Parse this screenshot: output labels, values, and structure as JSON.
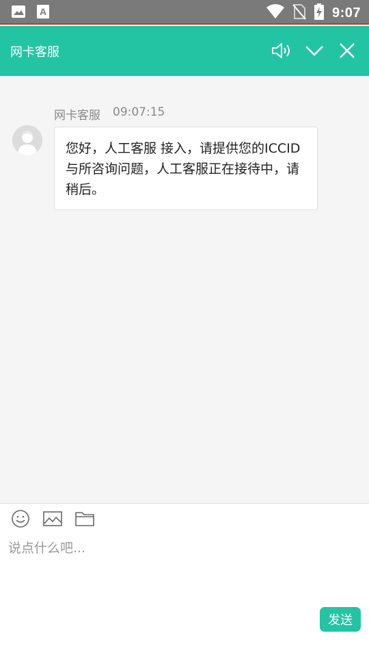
{
  "status_bar": {
    "time": "9:07",
    "icons": [
      "image-icon",
      "font-icon",
      "wifi-icon",
      "no-sim-icon",
      "battery-charging-icon"
    ]
  },
  "header": {
    "title": "网卡客服",
    "icons": [
      "volume-icon",
      "chevron-down-icon",
      "close-icon"
    ],
    "accent_color": "#23c4a3"
  },
  "chat": {
    "messages": [
      {
        "sender": "网卡客服",
        "time": "09:07:15",
        "text": "您好，人工客服 接入，请提供您的ICCID与所咨询问题，人工客服正在接待中，请稍后。"
      }
    ]
  },
  "input": {
    "placeholder": "说点什么吧...",
    "value": "",
    "tools": [
      "emoji-icon",
      "image-icon",
      "folder-icon"
    ],
    "send_label": "发送"
  }
}
